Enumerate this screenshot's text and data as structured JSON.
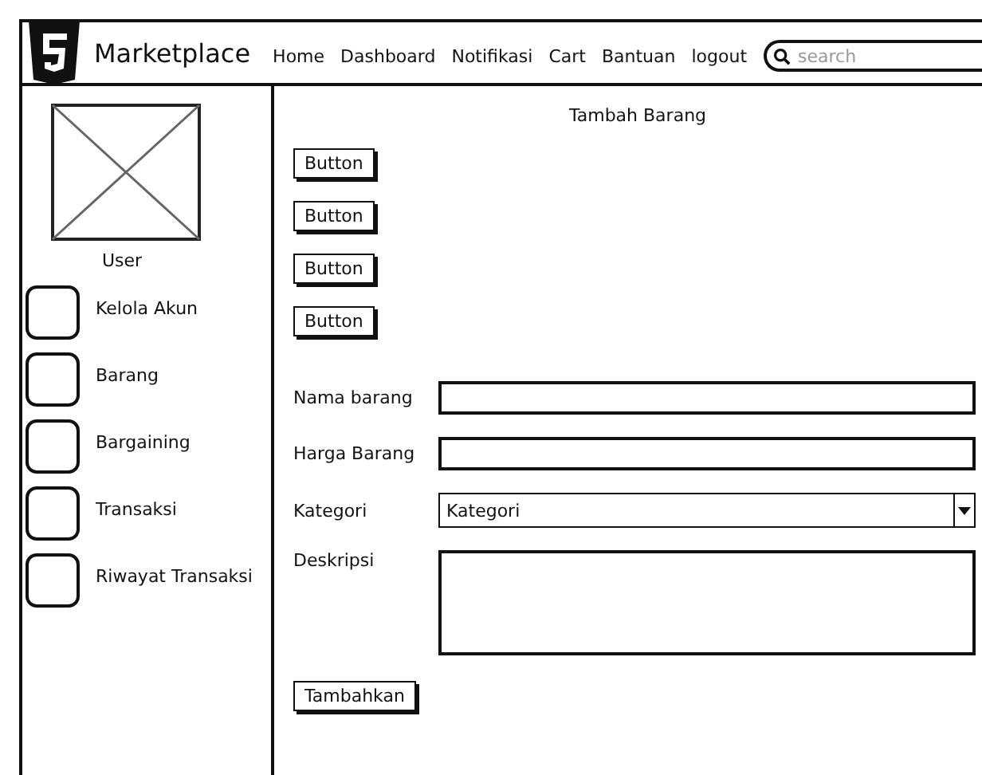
{
  "header": {
    "brand": "Marketplace",
    "nav": [
      {
        "label": "Home"
      },
      {
        "label": "Dashboard"
      },
      {
        "label": "Notifikasi"
      },
      {
        "label": "Cart"
      },
      {
        "label": "Bantuan"
      },
      {
        "label": "logout"
      }
    ],
    "search": {
      "placeholder": "search"
    }
  },
  "sidebar": {
    "user_label": "User",
    "items": [
      {
        "label": "Kelola Akun"
      },
      {
        "label": "Barang"
      },
      {
        "label": "Bargaining"
      },
      {
        "label": "Transaksi"
      },
      {
        "label": "Riwayat Transaksi"
      }
    ]
  },
  "main": {
    "title": "Tambah Barang",
    "buttons": [
      "Button",
      "Button",
      "Button",
      "Button"
    ],
    "fields": [
      {
        "kind": "text",
        "label": "Nama barang"
      },
      {
        "kind": "text",
        "label": "Harga Barang"
      },
      {
        "kind": "select",
        "label": "Kategori",
        "value": "Kategori"
      },
      {
        "kind": "textarea",
        "label": "Deskripsi"
      }
    ],
    "submit": "Tambahkan"
  }
}
